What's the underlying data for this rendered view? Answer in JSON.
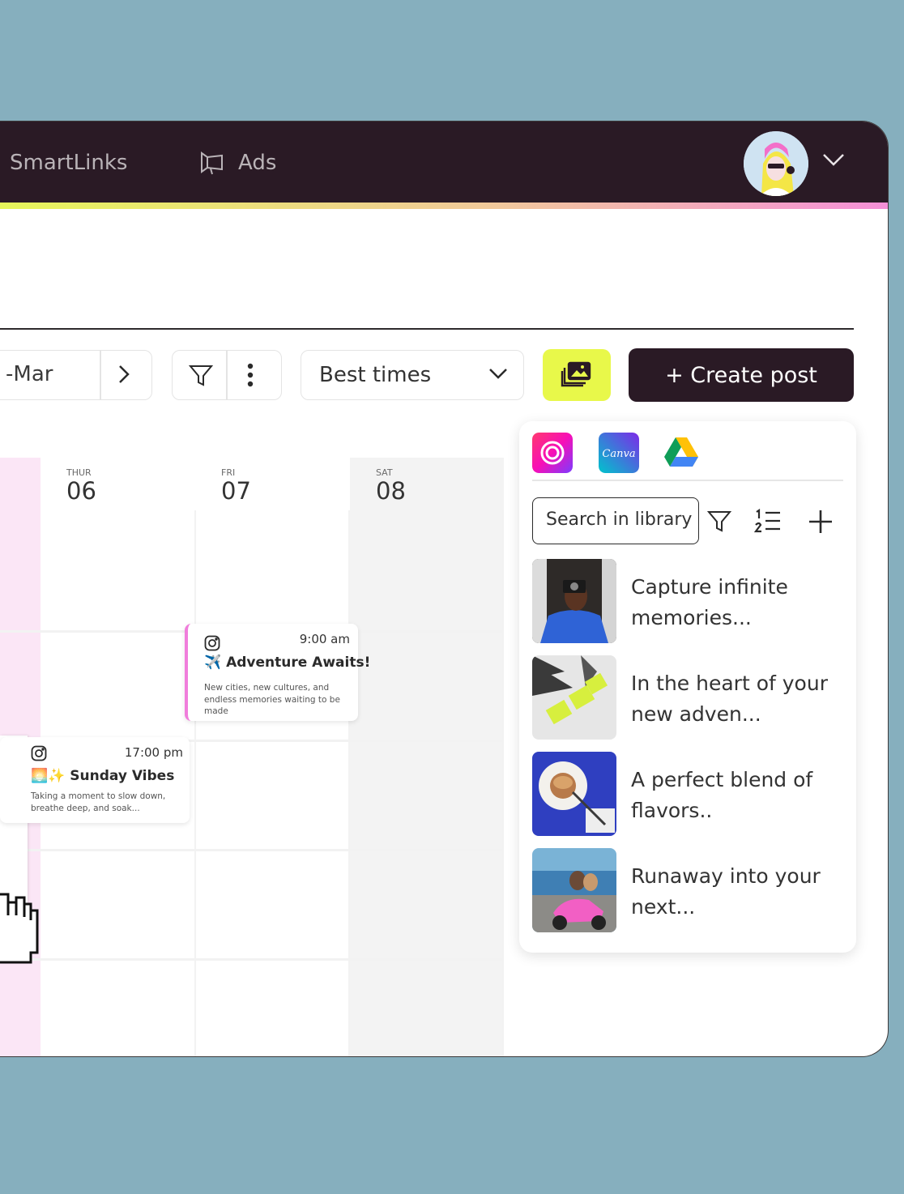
{
  "nav": {
    "smartlinks_label": "SmartLinks",
    "ads_label": "Ads"
  },
  "toolbar": {
    "date_range": "-Mar",
    "best_times_label": "Best times",
    "create_post_label": "+ Create post"
  },
  "calendar": {
    "days": [
      {
        "name": "THUR",
        "date": "06"
      },
      {
        "name": "FRI",
        "date": "07"
      },
      {
        "name": "SAT",
        "date": "08"
      }
    ],
    "posts": [
      {
        "time": "9:00 am",
        "title": "✈️ Adventure Awaits!",
        "description": "New cities, new cultures, and endless memories waiting to be made"
      },
      {
        "time": "17:00 pm",
        "title": "🌅✨ Sunday Vibes",
        "description": "Taking a moment to slow down, breathe deep, and soak..."
      }
    ]
  },
  "library": {
    "sources": [
      "adobe-creative-cloud-icon",
      "canva-icon",
      "google-drive-icon"
    ],
    "canva_text": "Canva",
    "search_placeholder": "Search in library",
    "items": [
      {
        "caption": "Capture infinite memories..."
      },
      {
        "caption": "In the heart of your new adven..."
      },
      {
        "caption": "A perfect blend of flavors.."
      },
      {
        "caption": "Runaway into your next..."
      }
    ]
  },
  "colors": {
    "background": "#86afbe",
    "topbar": "#2a1a25",
    "accent_lime": "#e8f84a",
    "accent_pink": "#f07ddb",
    "create_button": "#2a1a25"
  }
}
